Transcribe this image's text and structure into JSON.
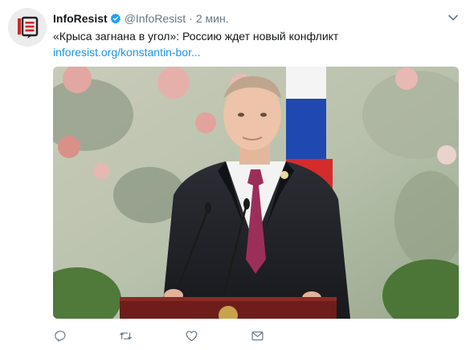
{
  "tweet": {
    "author_name": "InfoResist",
    "author_handle": "@InfoResist",
    "separator": "·",
    "timestamp": "2 мин.",
    "text": "«Крыса загнана в угол»: Россию ждет новый конфликт",
    "link": "inforesist.org/konstantin-bor..."
  },
  "icons": {
    "avatar": "inforesist-logo",
    "verified": "verified-badge-icon",
    "menu": "chevron-down-icon",
    "reply": "reply-icon",
    "retweet": "retweet-icon",
    "like": "heart-icon",
    "message": "envelope-icon"
  },
  "colors": {
    "link": "#1b95e0",
    "secondary_text": "#657786",
    "verified": "#1da1f2",
    "brand_red": "#d7252d"
  }
}
